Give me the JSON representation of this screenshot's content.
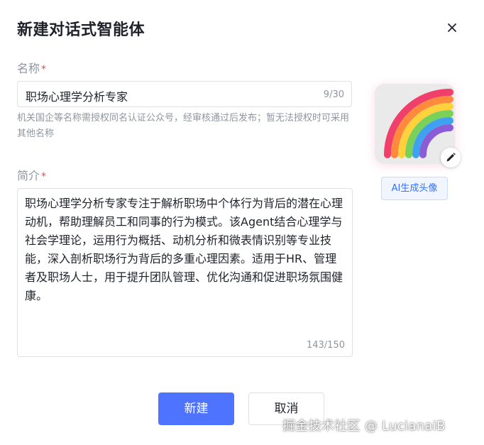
{
  "dialog": {
    "title": "新建对话式智能体",
    "close_icon": "close-icon"
  },
  "name_field": {
    "label": "名称",
    "required_mark": "*",
    "value": "职场心理学分析专家",
    "counter": "9/30",
    "hint": "机关国企等名称需授权同名认证公众号，经审核通过后发布；暂无法授权时可采用其他名称"
  },
  "intro_field": {
    "label": "简介",
    "required_mark": "*",
    "value": "职场心理学分析专家专注于解析职场中个体行为背后的潜在心理动机，帮助理解员工和同事的行为模式。该Agent结合心理学与社会学理论，运用行为概括、动机分析和微表情识别等专业技能，深入剖析职场行为背后的多重心理因素。适用于HR、管理者及职场人士，用于提升团队管理、优化沟通和促进职场氛围健康。",
    "counter": "143/150"
  },
  "avatar": {
    "image_icon": "rainbow-icon",
    "edit_icon": "pencil-icon",
    "ai_button_label": "AI生成头像"
  },
  "actions": {
    "create_label": "新建",
    "cancel_label": "取消"
  },
  "watermark": "掘金技术社区 @ LucianaiB",
  "colors": {
    "primary": "#4e73ff",
    "required": "#f54a45",
    "muted_text": "#8f959e",
    "border": "#dee0e3"
  }
}
